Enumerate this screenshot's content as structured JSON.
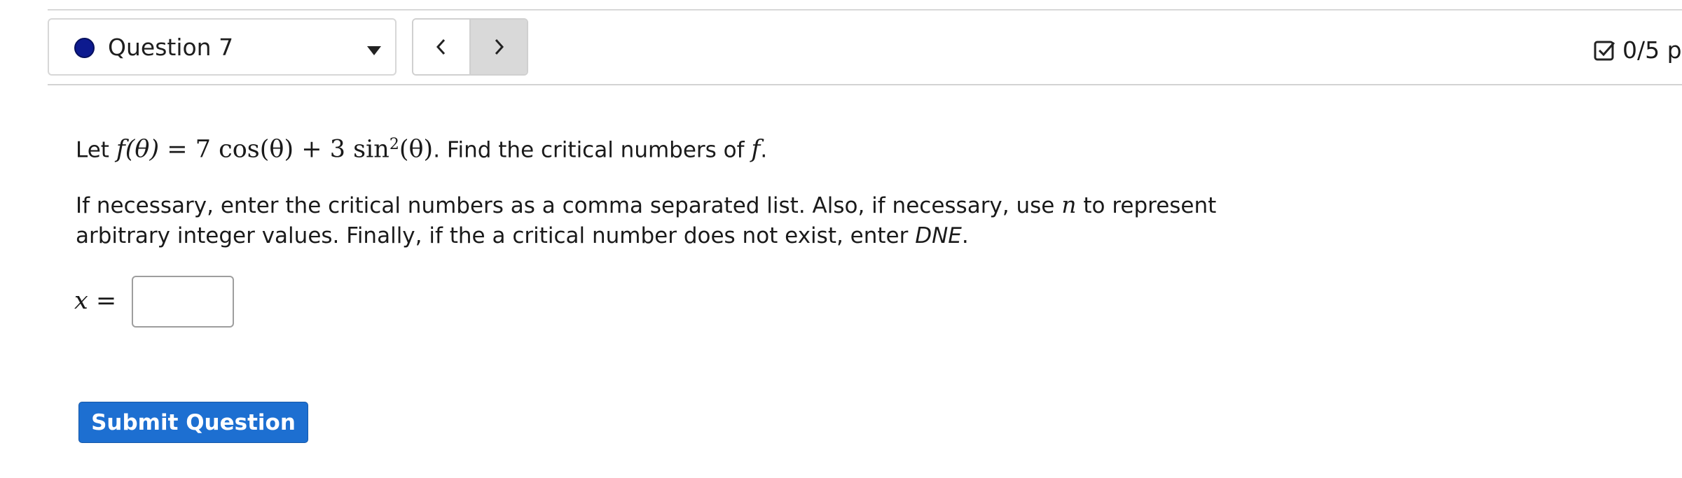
{
  "header": {
    "question_selector": {
      "label": "Question 7",
      "status_color": "#0d1a8f"
    },
    "nav": {
      "prev_icon": "chevron-left-icon",
      "next_icon": "chevron-right-icon"
    },
    "points": {
      "icon": "checkbox-icon",
      "text": "0/5 p"
    }
  },
  "question": {
    "prompt_prefix": "Let ",
    "prompt_mid": ". Find the critical numbers of ",
    "prompt_end": ".",
    "math_f_theta": "f(θ)",
    "math_eq": " = 7 cos(θ) + 3 sin",
    "math_sq": "2",
    "math_tail": "(θ)",
    "math_f": "f",
    "instructions_line1_a": "If necessary, enter the critical numbers as a comma separated list. Also, if necessary, use ",
    "instructions_var_n": "n",
    "instructions_line1_b": " to represent",
    "instructions_line2_a": "arbitrary integer values. Finally, if the a critical number does not exist, enter ",
    "instructions_dne": "DNE",
    "instructions_line2_b": "."
  },
  "answer": {
    "label": "x =",
    "value": "",
    "placeholder": ""
  },
  "actions": {
    "submit_label": "Submit Question",
    "submit_color": "#1d6fd1"
  }
}
